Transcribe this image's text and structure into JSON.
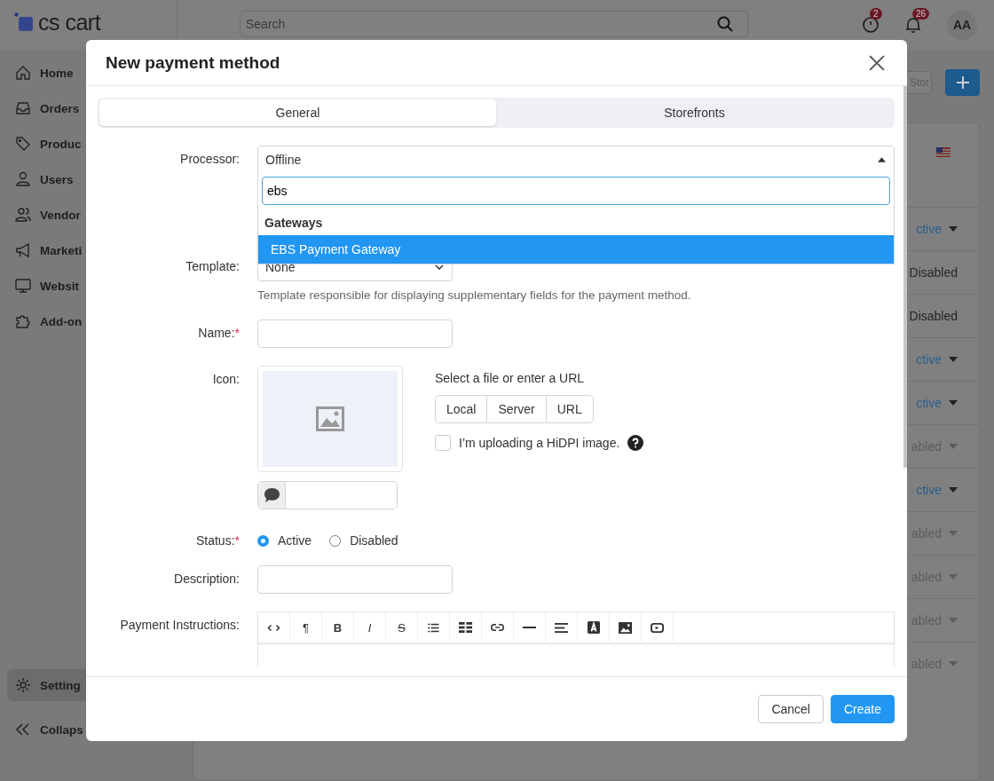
{
  "header": {
    "logo": "cs cart",
    "search": {
      "placeholder": "Search"
    },
    "help_badge": "2",
    "notifications_badge": "26",
    "avatar": "AA"
  },
  "sidebar": {
    "items": [
      {
        "label": "Home",
        "kind": "home",
        "selected": false
      },
      {
        "label": "Orders",
        "kind": "inbox",
        "selected": false
      },
      {
        "label": "Produc",
        "kind": "tag",
        "selected": false
      },
      {
        "label": "Users",
        "kind": "user",
        "selected": false
      },
      {
        "label": "Vendor",
        "kind": "users",
        "selected": false
      },
      {
        "label": "Marketi",
        "kind": "megaphone",
        "selected": false
      },
      {
        "label": "Websit",
        "kind": "monitor",
        "selected": false
      },
      {
        "label": "Add-on",
        "kind": "puzzle",
        "selected": false
      },
      {
        "label": "Setting",
        "kind": "gear",
        "selected": true
      }
    ],
    "collapse": "Collaps"
  },
  "main": {
    "store_button": "Stor",
    "status_list": [
      {
        "label": "ctive",
        "kind": "active"
      },
      {
        "label": "Disabled",
        "kind": "plain"
      },
      {
        "label": "Disabled",
        "kind": "plain"
      },
      {
        "label": "ctive",
        "kind": "active"
      },
      {
        "label": "ctive",
        "kind": "active"
      },
      {
        "label": "abled",
        "kind": "disabled"
      },
      {
        "label": "ctive",
        "kind": "active"
      },
      {
        "label": "abled",
        "kind": "disabled"
      },
      {
        "label": "abled",
        "kind": "disabled"
      },
      {
        "label": "abled",
        "kind": "disabled"
      },
      {
        "label": "abled",
        "kind": "disabled"
      }
    ]
  },
  "dialog": {
    "title": "New payment method",
    "tabs": [
      {
        "label": "General",
        "selected": true
      },
      {
        "label": "Storefronts",
        "selected": false
      }
    ],
    "processor": {
      "label": "Processor:",
      "value": "Offline",
      "expanded": true,
      "search": "ebs",
      "group": "Gateways",
      "options": [
        {
          "label": "EBS Payment Gateway",
          "selected": true
        }
      ]
    },
    "template": {
      "label": "Template:",
      "value": "None",
      "help": "Template responsible for displaying supplementary fields for the payment method."
    },
    "name": {
      "label": "Name:",
      "required_mark": "*"
    },
    "icon": {
      "label": "Icon:",
      "source_prompt": "Select a file or enter a URL",
      "sources": [
        "Local",
        "Server",
        "URL"
      ],
      "hidpi": {
        "label": "I’m uploading a HiDPI image.",
        "checked": false
      }
    },
    "status": {
      "label": "Status:",
      "required_mark": "*",
      "options": [
        {
          "label": "Active",
          "selected": true
        },
        {
          "label": "Disabled",
          "selected": false
        }
      ]
    },
    "description": {
      "label": "Description:"
    },
    "instructions": {
      "label": "Payment Instructions:",
      "toolbar": [
        {
          "kind": "code"
        },
        {
          "kind": "paragraph",
          "label": "¶"
        },
        {
          "kind": "bold",
          "label": "B"
        },
        {
          "kind": "italic",
          "label": "I"
        },
        {
          "kind": "strike",
          "label": "S"
        },
        {
          "kind": "list"
        },
        {
          "kind": "table"
        },
        {
          "kind": "link"
        },
        {
          "kind": "rule"
        },
        {
          "kind": "align"
        },
        {
          "kind": "font-color"
        },
        {
          "kind": "image"
        },
        {
          "kind": "video"
        }
      ]
    },
    "buttons": [
      {
        "label": "Cancel",
        "kind": "secondary"
      },
      {
        "label": "Create",
        "kind": "primary"
      }
    ]
  }
}
